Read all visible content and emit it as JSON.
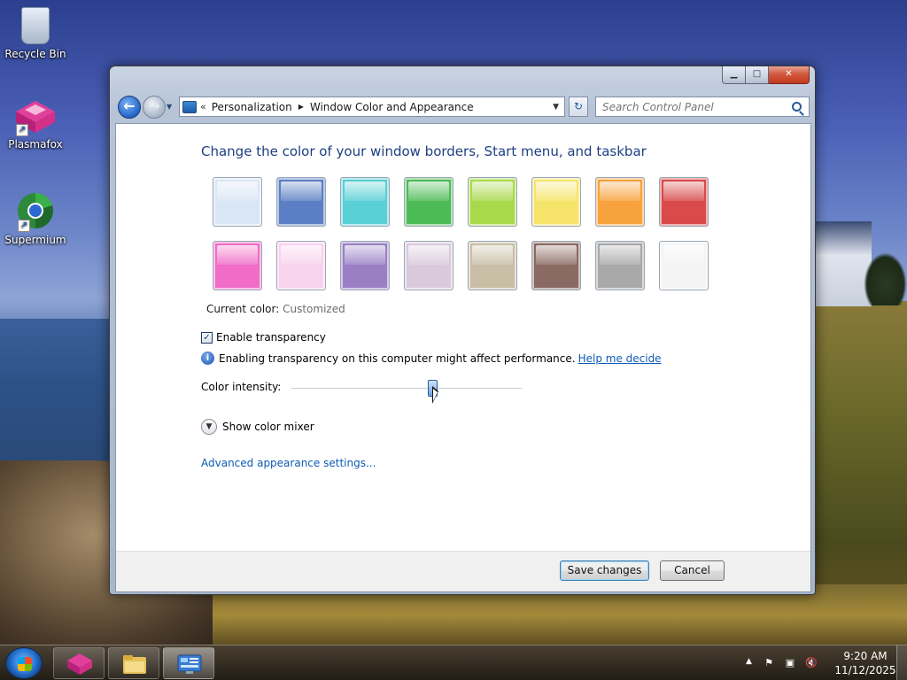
{
  "desktop": {
    "icons": [
      {
        "label": "Recycle Bin",
        "icon": "recycle-bin-icon"
      },
      {
        "label": "Plasmafox",
        "icon": "plasmafox-icon"
      },
      {
        "label": "Supermium",
        "icon": "supermium-icon"
      }
    ]
  },
  "window": {
    "caption_buttons": {
      "minimize": "▁",
      "maximize": "□",
      "close": "✕"
    },
    "address": {
      "breadcrumb": [
        "Personalization",
        "Window Color and Appearance"
      ]
    },
    "search": {
      "placeholder": "Search Control Panel"
    }
  },
  "content": {
    "heading": "Change the color of your window borders, Start menu, and taskbar",
    "swatch_colors": [
      "#d9e6f5",
      "#5b7fc4",
      "#59cfd6",
      "#4dbb55",
      "#a8d94b",
      "#f6e46a",
      "#f7a23c",
      "#d94a4a",
      "#f06cc6",
      "#f9d2ee",
      "#9a7fc5",
      "#d9c9dd",
      "#c9bea6",
      "#8a6a62",
      "#a9a9a9",
      "#f4f4f4"
    ],
    "current_color_label": "Current color:",
    "current_color_value": "Customized",
    "transparency": {
      "label": "Enable transparency",
      "checked": true
    },
    "info": {
      "text": "Enabling transparency on this computer might affect performance.",
      "link": "Help me decide"
    },
    "intensity": {
      "label": "Color intensity:",
      "value": 0.6
    },
    "mixer_label": "Show color mixer",
    "advanced_link": "Advanced appearance settings..."
  },
  "footer": {
    "save_label": "Save changes",
    "cancel_label": "Cancel"
  },
  "taskbar": {
    "clock_time": "9:20 AM",
    "clock_date": "11/12/2025"
  }
}
